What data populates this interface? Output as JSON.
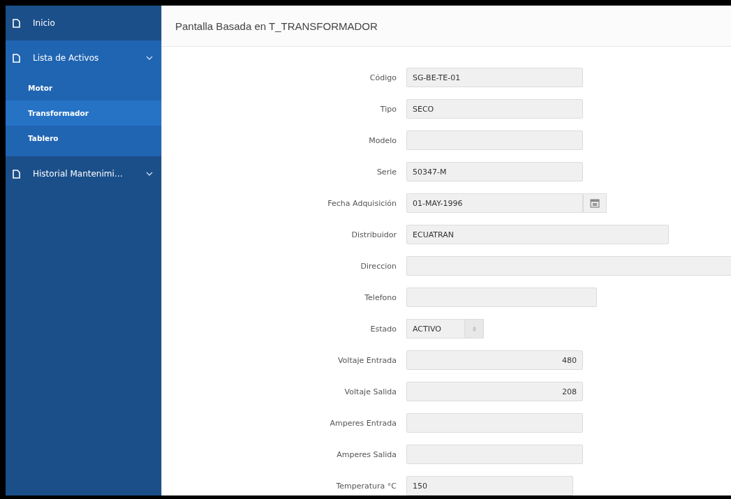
{
  "sidebar": {
    "items": [
      {
        "label": "Inicio"
      },
      {
        "label": "Lista de Activos",
        "expanded": true,
        "children": [
          {
            "label": "Motor",
            "selected": false
          },
          {
            "label": "Transformador",
            "selected": true
          },
          {
            "label": "Tablero",
            "selected": false
          }
        ]
      },
      {
        "label": "Historial Mantenimi…",
        "expanded": false
      }
    ]
  },
  "region": {
    "title": "Pantalla Basada en T_TRANSFORMADOR"
  },
  "form": {
    "fields": [
      {
        "label": "Código",
        "kind": "text",
        "value": "SG-BE-TE-01"
      },
      {
        "label": "Tipo",
        "kind": "text",
        "value": "SECO"
      },
      {
        "label": "Modelo",
        "kind": "text"
      },
      {
        "label": "Serie",
        "kind": "text",
        "value": "50347-M"
      },
      {
        "label": "Fecha Adquisición",
        "kind": "date",
        "value": "01-MAY-1996"
      },
      {
        "label": "Distribuidor",
        "kind": "text",
        "value": "ECUATRAN"
      },
      {
        "label": "Direccion",
        "kind": "text"
      },
      {
        "label": "Telefono",
        "kind": "text"
      },
      {
        "label": "Estado",
        "kind": "select",
        "value": "ACTIVO"
      },
      {
        "label": "Voltaje Entrada",
        "kind": "number",
        "value": "480"
      },
      {
        "label": "Voltaje Salida",
        "kind": "number",
        "value": "208"
      },
      {
        "label": "Amperes Entrada",
        "kind": "number"
      },
      {
        "label": "Amperes Salida",
        "kind": "number"
      },
      {
        "label": "Temperatura °C",
        "kind": "text",
        "value": "150"
      }
    ]
  }
}
